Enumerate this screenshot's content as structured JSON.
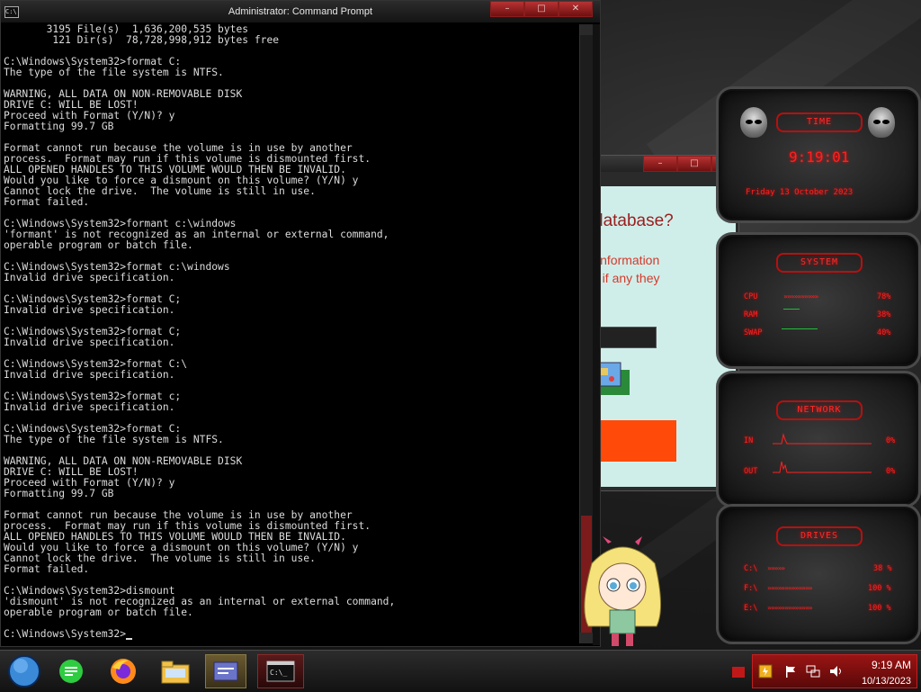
{
  "cmd": {
    "title": "Administrator: Command Prompt",
    "icon_text": "C:\\",
    "lines": [
      "       3195 File(s)  1,636,200,535 bytes",
      "        121 Dir(s)  78,728,998,912 bytes free",
      "",
      "C:\\Windows\\System32>format C:",
      "The type of the file system is NTFS.",
      "",
      "WARNING, ALL DATA ON NON-REMOVABLE DISK",
      "DRIVE C: WILL BE LOST!",
      "Proceed with Format (Y/N)? y",
      "Formatting 99.7 GB",
      "",
      "Format cannot run because the volume is in use by another",
      "process.  Format may run if this volume is dismounted first.",
      "ALL OPENED HANDLES TO THIS VOLUME WOULD THEN BE INVALID.",
      "Would you like to force a dismount on this volume? (Y/N) y",
      "Cannot lock the drive.  The volume is still in use.",
      "Format failed.",
      "",
      "C:\\Windows\\System32>formant c:\\windows",
      "'formant' is not recognized as an internal or external command,",
      "operable program or batch file.",
      "",
      "C:\\Windows\\System32>format c:\\windows",
      "Invalid drive specification.",
      "",
      "C:\\Windows\\System32>format C;",
      "Invalid drive specification.",
      "",
      "C:\\Windows\\System32>format C;",
      "Invalid drive specification.",
      "",
      "C:\\Windows\\System32>format C:\\",
      "Invalid drive specification.",
      "",
      "C:\\Windows\\System32>format c;",
      "Invalid drive specification.",
      "",
      "C:\\Windows\\System32>format C:",
      "The type of the file system is NTFS.",
      "",
      "WARNING, ALL DATA ON NON-REMOVABLE DISK",
      "DRIVE C: WILL BE LOST!",
      "Proceed with Format (Y/N)? y",
      "Formatting 99.7 GB",
      "",
      "Format cannot run because the volume is in use by another",
      "process.  Format may run if this volume is dismounted first.",
      "ALL OPENED HANDLES TO THIS VOLUME WOULD THEN BE INVALID.",
      "Would you like to force a dismount on this volume? (Y/N) y",
      "Cannot lock the drive.  The volume is still in use.",
      "Format failed.",
      "",
      "C:\\Windows\\System32>dismount",
      "'dismount' is not recognized as an internal or external command,",
      "operable program or batch file.",
      "",
      "C:\\Windows\\System32>"
    ]
  },
  "bg_window": {
    "title": "database?",
    "info_line1": "information",
    "info_line2": "e if any they"
  },
  "gadgets": {
    "time": {
      "header": "TIME",
      "clock": "9:19:01",
      "date": "Friday 13 October 2023"
    },
    "system": {
      "header": "SYSTEM",
      "rows": [
        {
          "label": "CPU",
          "value": "78%"
        },
        {
          "label": "RAM",
          "value": "38%"
        },
        {
          "label": "SWAP",
          "value": "40%"
        }
      ]
    },
    "network": {
      "header": "NETWORK",
      "rows": [
        {
          "label": "IN",
          "value": "0%"
        },
        {
          "label": "OUT",
          "value": "0%"
        }
      ]
    },
    "drives": {
      "header": "DRIVES",
      "rows": [
        {
          "label": "C:\\",
          "value": "38 %"
        },
        {
          "label": "F:\\",
          "value": "100 %"
        },
        {
          "label": "E:\\",
          "value": "100 %"
        }
      ]
    }
  },
  "taskbar": {
    "apps": [
      "start-orb-icon",
      "green-chat-icon",
      "firefox-icon",
      "file-explorer-icon",
      "control-panel-icon",
      "command-prompt-icon"
    ],
    "clock_time": "9:19 AM",
    "clock_date": "10/13/2023"
  },
  "colors": {
    "accent_red": "#ff2020",
    "console_bg": "#000000",
    "console_fg": "#dcdcdc"
  }
}
